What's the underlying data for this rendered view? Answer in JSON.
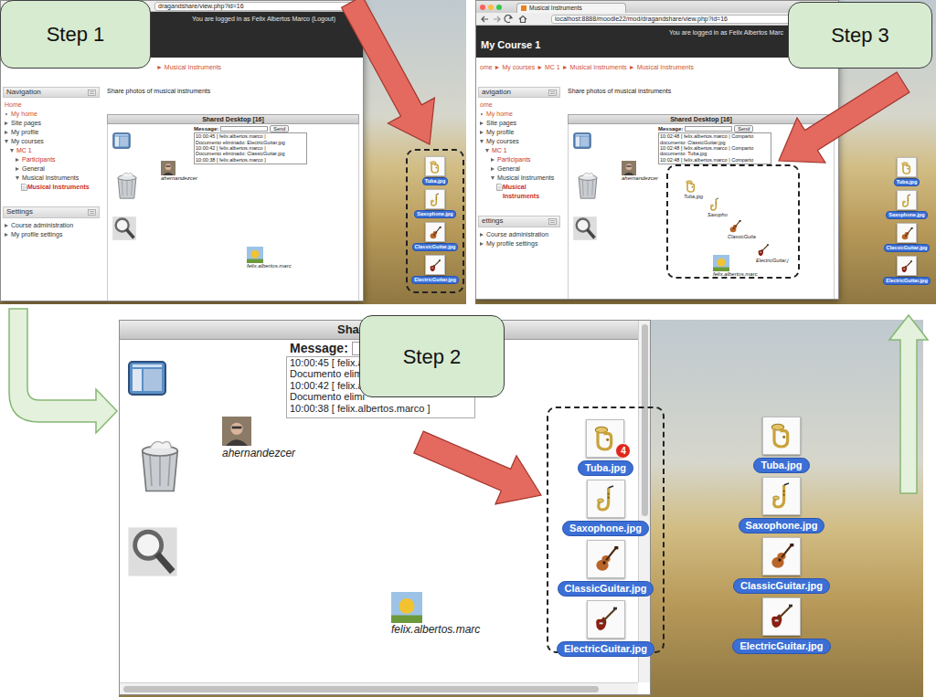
{
  "steps": {
    "step1": "Step 1",
    "step2": "Step 2",
    "step3": "Step 3"
  },
  "step1": {
    "browser": {
      "url": "dragandshare/view.php?id=16",
      "login": "You are logged in as Felix Albertos Marco (Logout)",
      "breadcrumb": "► Musical Instruments",
      "navigation": {
        "title": "Navigation",
        "items": [
          {
            "label": "Home",
            "kind": "home"
          },
          {
            "label": "My home",
            "kind": "bullet"
          },
          {
            "label": "Site pages",
            "kind": "branch",
            "expanded": false
          },
          {
            "label": "My profile",
            "kind": "branch",
            "expanded": false
          },
          {
            "label": "My courses",
            "kind": "branch",
            "expanded": true,
            "children": [
              {
                "label": "MC 1",
                "kind": "branch-link",
                "expanded": true,
                "children": [
                  {
                    "label": "Participants",
                    "kind": "branch-link",
                    "expanded": false
                  },
                  {
                    "label": "General",
                    "kind": "branch",
                    "expanded": false
                  },
                  {
                    "label": "Musical Instruments",
                    "kind": "branch",
                    "expanded": true,
                    "children": [
                      {
                        "label": "Musical Instruments",
                        "kind": "page"
                      }
                    ]
                  }
                ]
              }
            ]
          }
        ]
      },
      "settings": {
        "title": "Settings",
        "items": [
          {
            "label": "Course administration",
            "kind": "branch",
            "expanded": false
          },
          {
            "label": "My profile settings",
            "kind": "branch",
            "expanded": false
          }
        ]
      },
      "intro": "Share photos of musical instruments",
      "desktop": {
        "title": "Shared Desktop [16]",
        "message_label": "Message:",
        "send_label": "Send",
        "log": [
          "10:00:45 [ felix.albertos.marco |",
          "Documento eliminado: ElectricGuitar.jpg",
          "10:00:42 [ felix.albertos.marco |",
          "Documento eliminado: ClassicGuitar.jpg",
          "10:00:38 [ felix.albertos.marco ]"
        ],
        "users": [
          {
            "name": "ahernandezcer",
            "kind": "photo"
          },
          {
            "name": "felix.albertos.marc",
            "kind": "sun"
          }
        ]
      }
    },
    "desktop_icons": [
      {
        "label": "Tuba.jpg",
        "kind": "tuba"
      },
      {
        "label": "Saxophone.jpg",
        "kind": "saxophone"
      },
      {
        "label": "ClassicGuitar.jpg",
        "kind": "classic-guitar"
      },
      {
        "label": "ElectricGuitar.jpg",
        "kind": "electric-guitar"
      }
    ]
  },
  "step2": {
    "desktop": {
      "title": "Share",
      "message_label": "Message:",
      "log": [
        "10:00:45 [ felix.al",
        "Documento elimi",
        "10:00:42 [ felix.al",
        "Documento elimi",
        "10:00:38 [ felix.albertos.marco ]"
      ],
      "users": [
        {
          "name": "ahernandezcer",
          "kind": "photo"
        },
        {
          "name": "felix.albertos.marc",
          "kind": "sun"
        }
      ]
    },
    "files": [
      {
        "label": "Tuba.jpg",
        "kind": "tuba",
        "badge": "4"
      },
      {
        "label": "Saxophone.jpg",
        "kind": "saxophone"
      },
      {
        "label": "ClassicGuitar.jpg",
        "kind": "classic-guitar"
      },
      {
        "label": "ElectricGuitar.jpg",
        "kind": "electric-guitar"
      }
    ],
    "desktop_icons": [
      {
        "label": "Tuba.jpg",
        "kind": "tuba"
      },
      {
        "label": "Saxophone.jpg",
        "kind": "saxophone"
      },
      {
        "label": "ClassicGuitar.jpg",
        "kind": "classic-guitar"
      },
      {
        "label": "ElectricGuitar.jpg",
        "kind": "electric-guitar"
      }
    ]
  },
  "step3": {
    "browser": {
      "tab_title": "Musical Instruments",
      "url": "localhost:8888/moodle22/mod/dragandshare/view.php?id=16",
      "course": "My Course 1",
      "login": "You are logged in as Felix Albertos Marc",
      "breadcrumb": "ome ► My courses ► MC 1 ► Musical Instruments ► Musical Instruments",
      "navigation": {
        "title": "avigation",
        "items": [
          {
            "label": "ome",
            "kind": "home"
          },
          {
            "label": "My home",
            "kind": "bullet"
          },
          {
            "label": "Site pages",
            "kind": "branch",
            "expanded": false
          },
          {
            "label": "My profile",
            "kind": "branch",
            "expanded": false
          },
          {
            "label": "My courses",
            "kind": "branch",
            "expanded": true,
            "children": [
              {
                "label": "MC 1",
                "kind": "branch-link",
                "expanded": true,
                "children": [
                  {
                    "label": "Participants",
                    "kind": "branch-link",
                    "expanded": false
                  },
                  {
                    "label": "General",
                    "kind": "branch",
                    "expanded": false
                  },
                  {
                    "label": "Musical Instruments",
                    "kind": "branch",
                    "expanded": true,
                    "children": [
                      {
                        "label": "Musical Instruments",
                        "kind": "page"
                      }
                    ]
                  }
                ]
              }
            ]
          }
        ]
      },
      "settings": {
        "title": "ettings",
        "items": [
          {
            "label": "Course administration",
            "kind": "branch",
            "expanded": false
          },
          {
            "label": "My profile settings",
            "kind": "branch",
            "expanded": false
          }
        ]
      },
      "intro": "Share photos of musical instruments",
      "desktop": {
        "title": "Shared Desktop [16]",
        "message_label": "Message:",
        "send_label": "Send",
        "log": [
          "10:02:48 [ felix.albertos.marco | Comparto",
          "documento: ClassicGuitar.jpg",
          "10:02:48 [ felix.albertos.marco | Comparto",
          "documento: Tuba.jpg",
          "10:02:48 [ felix.albertos.marco | Comparto"
        ],
        "users": [
          {
            "name": "ahernandezcer",
            "kind": "photo"
          },
          {
            "name": "felix.albertos.marc",
            "kind": "sun"
          }
        ],
        "files": [
          {
            "label": "Tuba.jpg",
            "kind": "tuba"
          },
          {
            "label": "Saxopho",
            "kind": "saxophone"
          },
          {
            "label": "ClassicGuita",
            "kind": "classic-guitar"
          },
          {
            "label": "ElectricGuitar.j",
            "kind": "electric-guitar"
          }
        ]
      }
    },
    "desktop_icons": [
      {
        "label": "Tuba.jpg",
        "kind": "tuba"
      },
      {
        "label": "Saxophone.jpg",
        "kind": "saxophone"
      },
      {
        "label": "ClassicGuitar.jpg",
        "kind": "classic-guitar"
      },
      {
        "label": "ElectricGuitar.jpg",
        "kind": "electric-guitar"
      }
    ]
  }
}
